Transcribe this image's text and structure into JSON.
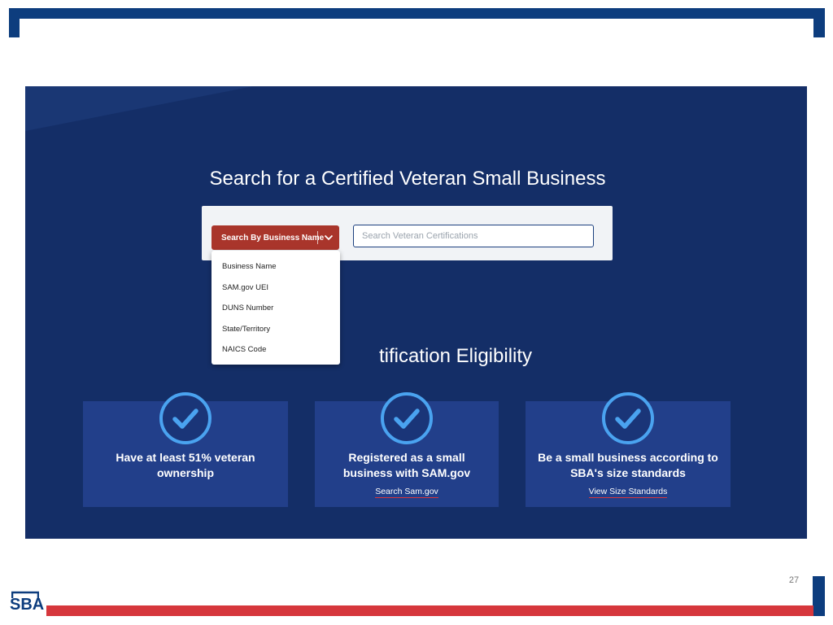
{
  "slide": {
    "page_number": "27",
    "logo_text": "SBA",
    "colors": {
      "navy": "#0d3d7e",
      "red": "#d6373c",
      "panel": "#142e67",
      "card": "#223f8a",
      "button": "#a9352b",
      "check": "#4aa3f0"
    }
  },
  "screen": {
    "headline": "Search for a Certified Veteran Small Business",
    "search": {
      "button_label": "Search By Business Name",
      "button_icon": "chevron-down-icon",
      "placeholder": "Search Veteran Certifications",
      "options": [
        "Business Name",
        "SAM.gov UEI",
        "DUNS Number",
        "State/Territory",
        "NAICS Code"
      ]
    },
    "eligibility": {
      "title_visible": "tification Eligibility",
      "cards": [
        {
          "icon": "check-circle-icon",
          "text": "Have at least 51% veteran ownership",
          "link": ""
        },
        {
          "icon": "check-circle-icon",
          "text": "Registered as a small business with SAM.gov",
          "link": "Search Sam.gov"
        },
        {
          "icon": "check-circle-icon",
          "text": "Be a small business according to SBA's size standards",
          "link": "View Size Standards"
        }
      ]
    }
  }
}
